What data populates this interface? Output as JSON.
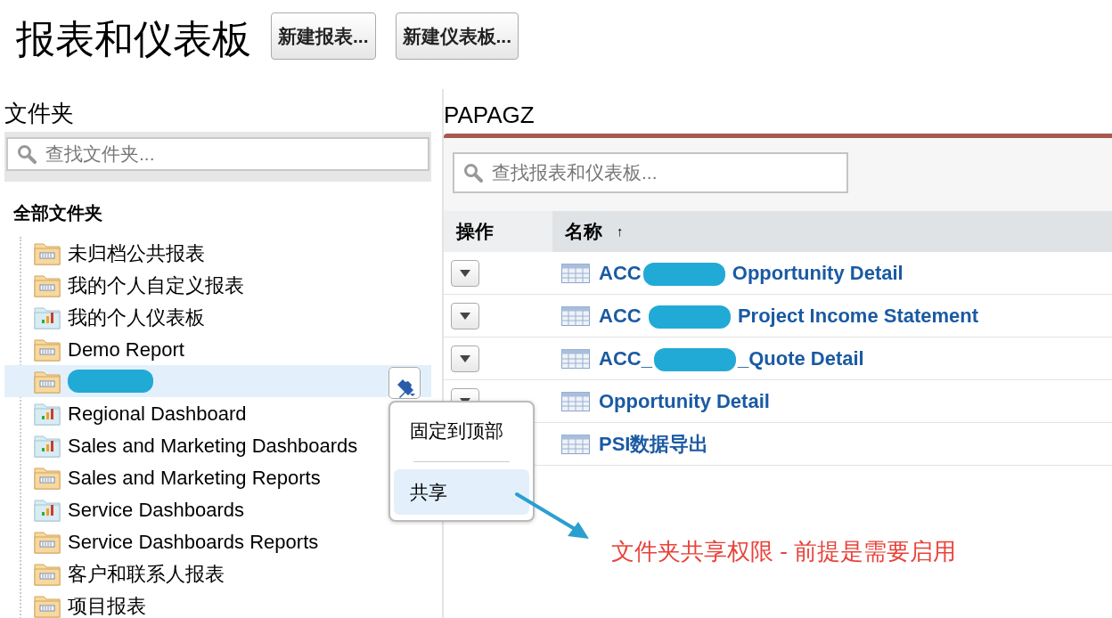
{
  "title": "报表和仪表板",
  "header_buttons": [
    "新建报表...",
    "新建仪表板..."
  ],
  "folders_heading": "文件夹",
  "folder_search": {
    "placeholder": "查找文件夹..."
  },
  "all_folders": "全部文件夹",
  "folders": [
    {
      "name": "未归档公共报表",
      "kind": "report",
      "selected": false
    },
    {
      "name": "我的个人自定义报表",
      "kind": "report",
      "selected": false
    },
    {
      "name": "我的个人仪表板",
      "kind": "dashboard",
      "selected": false
    },
    {
      "name": "Demo Report",
      "kind": "report",
      "selected": false
    },
    {
      "redacted": true,
      "kind": "report",
      "selected": true
    },
    {
      "name": "Regional Dashboard",
      "kind": "dashboard",
      "selected": false
    },
    {
      "name": "Sales and Marketing Dashboards",
      "kind": "dashboard",
      "selected": false
    },
    {
      "name": "Sales and Marketing Reports",
      "kind": "report",
      "selected": false
    },
    {
      "name": "Service Dashboards",
      "kind": "dashboard",
      "selected": false
    },
    {
      "name": "Service Dashboards Reports",
      "kind": "report",
      "selected": false
    },
    {
      "name": "客户和联系人报表",
      "kind": "report",
      "selected": false
    },
    {
      "name": "项目报表",
      "kind": "report",
      "selected": false
    }
  ],
  "folder_menu": [
    {
      "label": "固定到顶部",
      "selected": false
    },
    {
      "label": "共享",
      "selected": true
    }
  ],
  "panel_title": "PAPAGZ",
  "report_search": {
    "placeholder": "查找报表和仪表板..."
  },
  "table": {
    "columns": [
      "操作",
      "名称"
    ],
    "sort_mark": "↑",
    "rows": [
      {
        "before": "ACC",
        "redacted": true,
        "after": " Opportunity Detail",
        "menu_button": true
      },
      {
        "before": "ACC ",
        "redacted": true,
        "after": " Project Income Statement",
        "menu_button": true
      },
      {
        "before": "ACC_",
        "redacted": true,
        "after": "_Quote Detail",
        "menu_button": true
      },
      {
        "before": "Opportunity Detail",
        "redacted": false,
        "menu_button": true
      },
      {
        "before": "PSI数据导出",
        "redacted": false
      }
    ]
  },
  "annotation": "文件夹共享权限 - 前提是需要启用"
}
